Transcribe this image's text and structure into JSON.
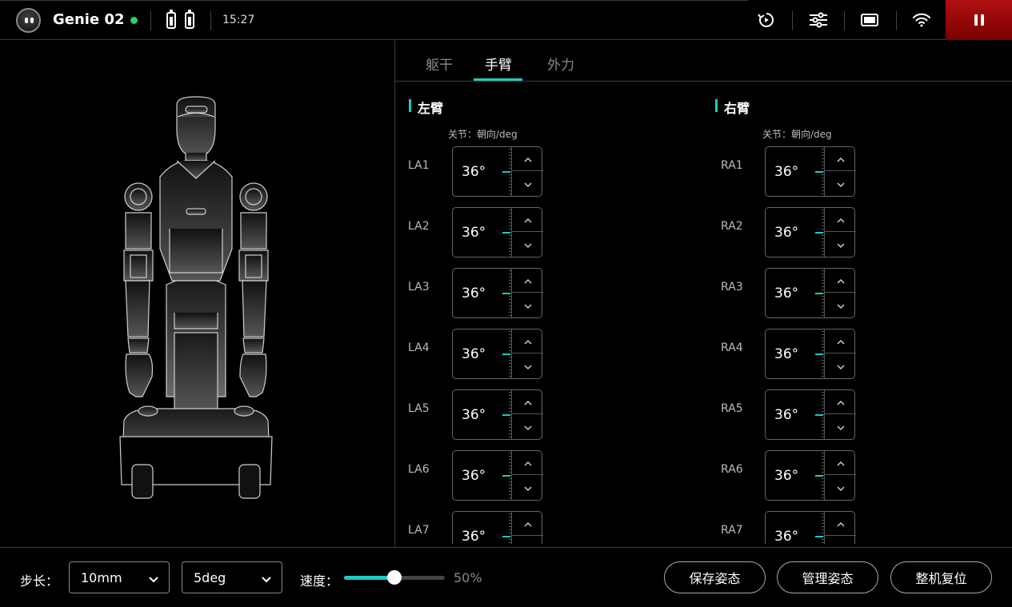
{
  "header": {
    "robot_name": "Genie 02",
    "time": "15:27",
    "icons": [
      "replay-icon",
      "sliders-icon",
      "screen-icon",
      "wifi-icon",
      "pause-icon"
    ]
  },
  "tabs": [
    {
      "label": "躯干",
      "active": false
    },
    {
      "label": "手臂",
      "active": true
    },
    {
      "label": "外力",
      "active": false
    }
  ],
  "left_arm": {
    "title": "左臂",
    "column_header": "关节：朝向/deg",
    "joints": [
      {
        "label": "LA1",
        "value": "36°"
      },
      {
        "label": "LA2",
        "value": "36°"
      },
      {
        "label": "LA3",
        "value": "36°"
      },
      {
        "label": "LA4",
        "value": "36°"
      },
      {
        "label": "LA5",
        "value": "36°"
      },
      {
        "label": "LA6",
        "value": "36°"
      },
      {
        "label": "LA7",
        "value": "36°"
      }
    ]
  },
  "right_arm": {
    "title": "右臂",
    "column_header": "关节：朝向/deg",
    "joints": [
      {
        "label": "RA1",
        "value": "36°"
      },
      {
        "label": "RA2",
        "value": "36°"
      },
      {
        "label": "RA3",
        "value": "36°"
      },
      {
        "label": "RA4",
        "value": "36°"
      },
      {
        "label": "RA5",
        "value": "36°"
      },
      {
        "label": "RA6",
        "value": "36°"
      },
      {
        "label": "RA7",
        "value": "36°"
      }
    ]
  },
  "bottom": {
    "step_label": "步长：",
    "step_mm": "10mm",
    "step_deg": "5deg",
    "speed_label": "速度：",
    "speed_percent": 50,
    "speed_text": "50%",
    "buttons": [
      "保存姿态",
      "管理姿态",
      "整机复位"
    ]
  },
  "colors": {
    "accent": "#1ec9c0",
    "pause_red": "#b01010",
    "online_green": "#2ad06a"
  }
}
